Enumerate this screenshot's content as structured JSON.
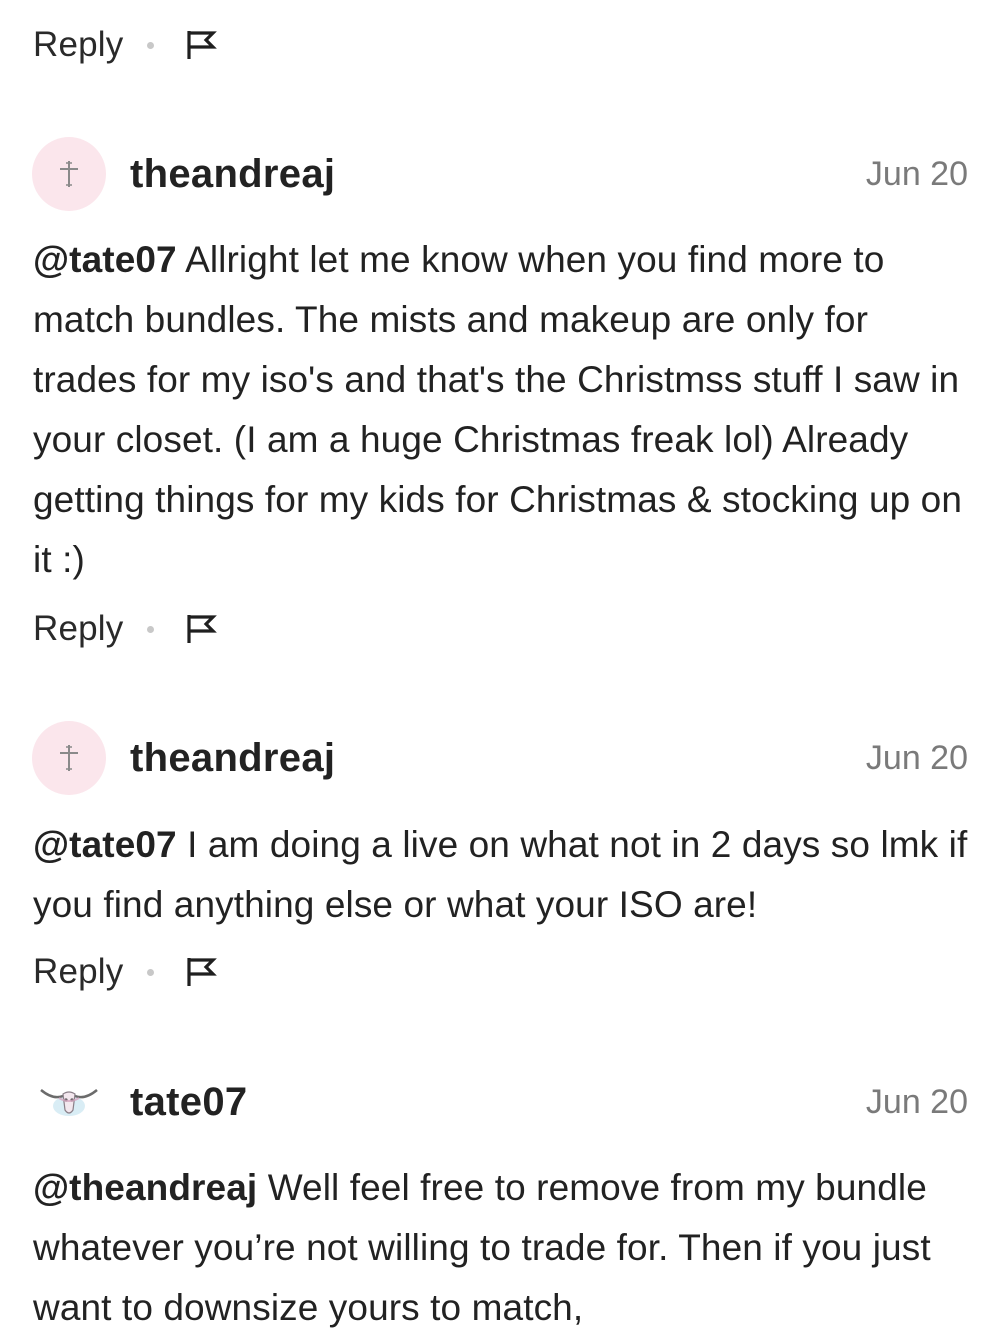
{
  "reply_label": "Reply",
  "top_actions": {
    "reply_label": "Reply"
  },
  "comments": [
    {
      "username": "theandreaj",
      "date": "Jun 20",
      "mention": "@tate07",
      "text": "Allright let me know when you find more to match bundles. The mists and makeup are only for trades for my iso's and that's the Christmss stuff I saw in your closet. (I am a huge Christmas freak lol) Already getting things for my kids for Christmas & stocking up on it :)",
      "reply_label": "Reply",
      "avatar_icon": "cross-icon"
    },
    {
      "username": "theandreaj",
      "date": "Jun 20",
      "mention": "@tate07",
      "text": "I am doing a live on what not in 2 days so lmk if you find anything else or what your ISO are!",
      "reply_label": "Reply",
      "avatar_icon": "cross-icon"
    },
    {
      "username": "tate07",
      "date": "Jun 20",
      "mention": "@theandreaj",
      "text": "Well feel free to remove from my bundle whatever you’re not willing to trade for. Then if you just want to downsize yours to match,",
      "avatar_icon": "longhorn-skull-icon"
    }
  ],
  "colors": {
    "avatar_pink": "#fbe6ec",
    "date_gray": "#7a7a7a",
    "dot_gray": "#c8c8c8",
    "text": "#222222"
  }
}
